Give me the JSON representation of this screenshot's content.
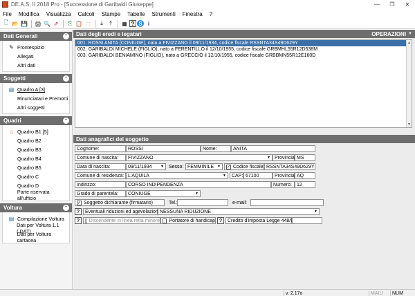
{
  "window": {
    "title": "DE.A.S. II 2018 Pro - [Successione di Garibaldi Giuseppe]",
    "minimize_glyph": "—",
    "restore_glyph": "❐",
    "close_glyph": "✕"
  },
  "menu": [
    "File",
    "Modifica",
    "Visualizza",
    "Calcoli",
    "Stampe",
    "Tabelle",
    "Strumenti",
    "Finestra",
    "?"
  ],
  "toolbar": {
    "icons": [
      "new-file-icon",
      "open-folder-icon",
      "save-icon",
      "print-icon",
      "print-preview-icon",
      "export-icon",
      "copy-icon",
      "paste-icon",
      "import-icon",
      "download-icon",
      "upload-icon",
      "calculator-icon",
      "help-icon",
      "skype-icon",
      "info-icon"
    ],
    "glyphs": [
      "🗋",
      "📂",
      "💾",
      "🖨",
      "🔍",
      "⇗",
      "⎘",
      "📋",
      "⬚",
      "⤓",
      "⤒",
      "▦",
      "?",
      "S",
      "i"
    ]
  },
  "sidebar": {
    "sections": [
      {
        "title": "Dati Generali",
        "items": [
          {
            "label": "Frontespizio",
            "icon": "✎",
            "underline": false
          },
          {
            "label": "Allegati",
            "icon": "",
            "underline": false
          },
          {
            "label": "Altri dati",
            "icon": "",
            "underline": false
          }
        ]
      },
      {
        "title": "Soggetti",
        "items": [
          {
            "label": "Quadro A [3]",
            "icon": "▤",
            "underline": true
          },
          {
            "label": "Rinunciatari e Premorti",
            "icon": "",
            "underline": false
          },
          {
            "label": "Altri soggetti",
            "icon": "",
            "underline": false
          }
        ]
      },
      {
        "title": "Quadri",
        "items": [
          {
            "label": "Quadro B1 [5]",
            "icon": "⌂",
            "underline": false
          },
          {
            "label": "Quadro B2",
            "icon": "",
            "underline": false
          },
          {
            "label": "Quadro B3",
            "icon": "",
            "underline": false
          },
          {
            "label": "Quadro B4",
            "icon": "",
            "underline": false
          },
          {
            "label": "Quadro B5",
            "icon": "",
            "underline": false
          },
          {
            "label": "Quadro C",
            "icon": "",
            "underline": false
          },
          {
            "label": "Quadro D",
            "icon": "",
            "underline": false
          },
          {
            "label": "Parte riservata all'ufficio",
            "icon": "",
            "underline": false
          }
        ]
      },
      {
        "title": "Voltura",
        "items": [
          {
            "label": "Compilazione Voltura",
            "icon": "▤",
            "underline": false
          },
          {
            "label": "Dati per Voltura 1.1 (.DAT)",
            "icon": "",
            "underline": false
          },
          {
            "label": "Dati per Voltura cartacea",
            "icon": "",
            "underline": false
          }
        ]
      }
    ],
    "collapse_glyph": "⌃"
  },
  "heirs_panel": {
    "title": "Dati degli eredi e legatari",
    "operations_label": "OPERAZIONI",
    "rows": [
      "001. ROSSI ANITA (CONIUGE), nata a FIVIZZANO il 09/11/1934, codice fiscale RSSNTA34S49D629Y",
      "002. GARIBALDI MICHELE (FIGLIO), nato a FERENTILLO il 12/10/1955, codice fiscale GRBMHL55R12D538M",
      "003. GARIBALDI BENIAMINO (FIGLIO), nato a GRECCIO il 12/10/1955, codice fiscale GRBBMN55R12E160D"
    ],
    "selected_index": 0
  },
  "subject_panel": {
    "title": "Dati anagrafici del soggetto",
    "cognome_label": "Cognome:",
    "cognome": "ROSSI",
    "nome_label": "Nome:",
    "nome": "ANITA",
    "comune_nascita_label": "Comune di nascita:",
    "comune_nascita": "FIVIZZANO",
    "provincia_label": "Provincia:",
    "provincia_nascita": "MS",
    "data_nascita_label": "Data di nascita:",
    "data_nascita": "09/11/1934",
    "sesso_label": "Sesso:",
    "sesso": "FEMMINILE",
    "codice_fiscale_label": "Codice fiscale:",
    "codice_fiscale": "RSSNTA34S49D629Y",
    "comune_residenza_label": "Comune di residenza:",
    "comune_residenza": "L'AQUILA",
    "cap_label": "CAP:",
    "cap": "67100",
    "provincia_residenza": "AQ",
    "indirizzo_label": "Indirizzo:",
    "indirizzo": "CORSO INDIPENDENZA",
    "numero_label": "Numero:",
    "numero": "12",
    "parentela_label": "Grado di parentela:",
    "parentela": "CONIUGE",
    "dichiarante_label": "Soggetto dichiarante (firmatario)",
    "tel_label": "Tel.:",
    "tel": "",
    "email_label": "e-mail:",
    "email": "",
    "riduzioni_label": "Eventuali riduzioni ed agevolazioni:",
    "riduzioni": "NESSUNA RIDUZIONE",
    "discendente_label": "Discendente in linea retta minore",
    "handicap_label": "Portatore di handicap",
    "credito_label": "Credito d'imposta Legge 448/98:",
    "credito": "",
    "check_glyph": "✓",
    "dropdown_glyph": "▼",
    "help_glyph": "?"
  },
  "statusbar": {
    "version": "v. 2.17o",
    "maiu": "MAIU",
    "num": "NUM"
  }
}
